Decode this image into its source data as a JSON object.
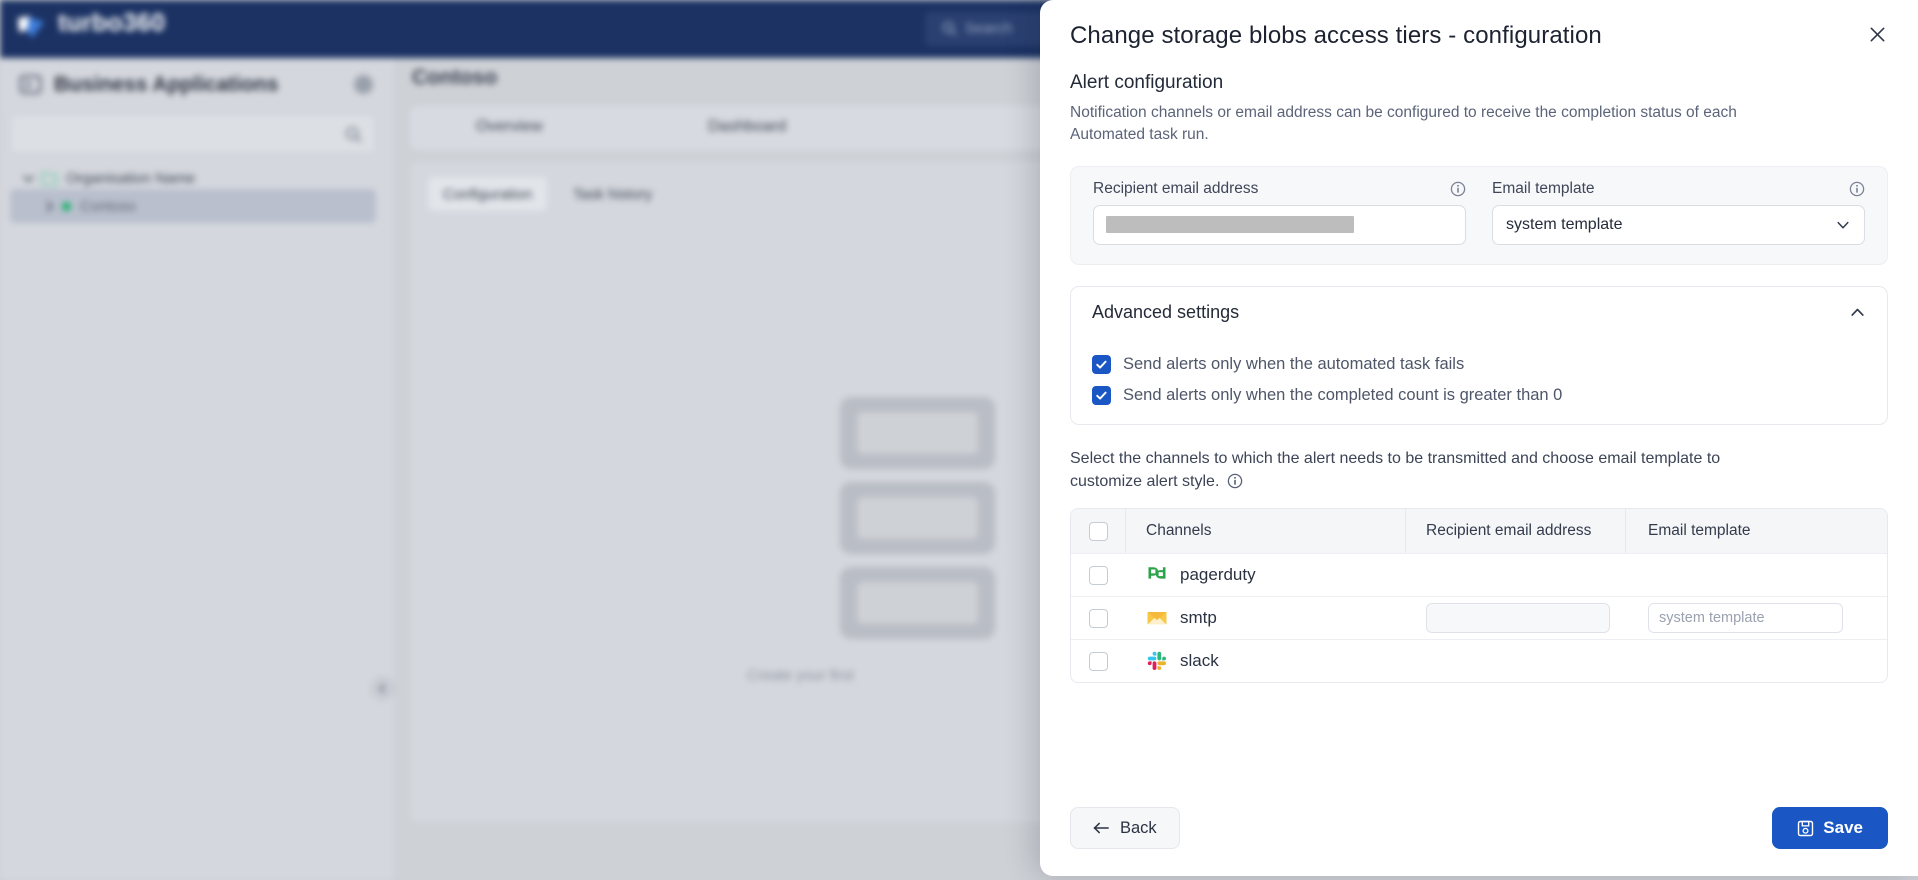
{
  "app": {
    "brand": "turbo360",
    "topbar_search_placeholder": "Search",
    "sidebar": {
      "header": "Business Applications",
      "search_value": "",
      "tree": [
        {
          "label": "Organisation Name"
        },
        {
          "label": "Contoso"
        }
      ]
    },
    "content": {
      "title": "Contoso",
      "tabs": [
        "Overview",
        "Dashboard"
      ],
      "subtabs": [
        "Configuration",
        "Task history"
      ],
      "empty_text": "Create your first"
    }
  },
  "modal": {
    "title": "Change storage blobs access tiers - configuration",
    "close_label": "Close",
    "alert_section": {
      "title": "Alert configuration",
      "description": "Notification channels or email address can be configured to receive the completion status of each Automated task run.",
      "recipient_label": "Recipient email address",
      "recipient_value": "",
      "template_label": "Email template",
      "template_value": "system template"
    },
    "advanced": {
      "title": "Advanced settings",
      "expanded": true,
      "options": [
        {
          "label": "Send alerts only when the automated task fails",
          "checked": true
        },
        {
          "label": "Send alerts only when the completed count is greater than 0",
          "checked": true
        }
      ]
    },
    "channels": {
      "description": "Select the channels to which the alert needs to be transmitted and choose email template to customize alert style.",
      "columns": [
        "Channels",
        "Recipient email address",
        "Email template"
      ],
      "header_checked": false,
      "rows": [
        {
          "name": "pagerduty",
          "icon": "pagerduty-icon",
          "checked": false,
          "has_inputs": false,
          "email_value": "",
          "template_placeholder": ""
        },
        {
          "name": "smtp",
          "icon": "smtp-icon",
          "checked": false,
          "has_inputs": true,
          "email_value": "",
          "template_placeholder": "system template"
        },
        {
          "name": "slack",
          "icon": "slack-icon",
          "checked": false,
          "has_inputs": false,
          "email_value": "",
          "template_placeholder": ""
        }
      ]
    },
    "footer": {
      "back_label": "Back",
      "save_label": "Save"
    }
  },
  "colors": {
    "primary": "#1a56c4",
    "topbar": "#1b3263",
    "pagerduty_green": "#2aa34a",
    "smtp_yellow": "#f5b93b"
  }
}
